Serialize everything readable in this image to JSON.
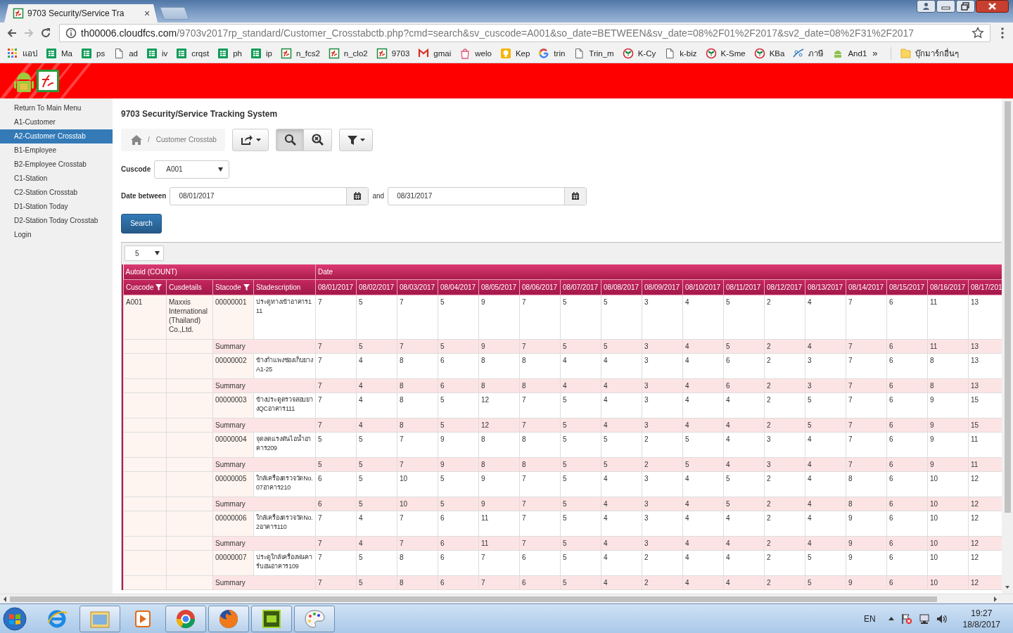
{
  "browser": {
    "tab_title": "9703 Security/Service Tra",
    "tab_close": "×",
    "url_host": "th00006.cloudfcs.com",
    "url_path": "/9703v2017rp_standard/Customer_Crosstabctb.php?cmd=search&sv_cuscode=A001&so_date=BETWEEN&sv_date=08%2F01%2F2017&sv2_date=08%2F31%2F2017",
    "bookmarks": [
      {
        "label": "แอป",
        "kind": "apps"
      },
      {
        "label": "Ma",
        "kind": "sheet"
      },
      {
        "label": "ps",
        "kind": "sheet"
      },
      {
        "label": "ad",
        "kind": "page"
      },
      {
        "label": "iv",
        "kind": "sheet"
      },
      {
        "label": "crqst",
        "kind": "sheet"
      },
      {
        "label": "ph",
        "kind": "sheet"
      },
      {
        "label": "ip",
        "kind": "sheet"
      },
      {
        "label": "n_fcs2",
        "kind": "fc"
      },
      {
        "label": "n_clo2",
        "kind": "fc"
      },
      {
        "label": "9703",
        "kind": "fc"
      },
      {
        "label": "gmai",
        "kind": "mail"
      },
      {
        "label": "welo",
        "kind": "bag"
      },
      {
        "label": "Kep",
        "kind": "bulb"
      },
      {
        "label": "trin",
        "kind": "google"
      },
      {
        "label": "Trin_m",
        "kind": "page"
      },
      {
        "label": "K-Cy",
        "kind": "bank"
      },
      {
        "label": "k-biz",
        "kind": "page"
      },
      {
        "label": "K-Sme",
        "kind": "bank"
      },
      {
        "label": "KBa",
        "kind": "bank"
      },
      {
        "label": "ภาษี",
        "kind": "swoosh"
      },
      {
        "label": "And1",
        "kind": "android"
      }
    ],
    "more_bookmarks": "»",
    "other_bookmarks": "บุ๊กมาร์กอื่นๆ"
  },
  "sidebar": {
    "items": [
      {
        "label": "Return To Main Menu",
        "selected": false
      },
      {
        "label": "A1-Customer",
        "selected": false
      },
      {
        "label": "A2-Customer Crosstab",
        "selected": true
      },
      {
        "label": "B1-Employee",
        "selected": false
      },
      {
        "label": "B2-Employee Crosstab",
        "selected": false
      },
      {
        "label": "C1-Station",
        "selected": false
      },
      {
        "label": "C2-Station Crosstab",
        "selected": false
      },
      {
        "label": "D1-Station Today",
        "selected": false
      },
      {
        "label": "D2-Station Today Crosstab",
        "selected": false
      },
      {
        "label": "Login",
        "selected": false
      }
    ]
  },
  "page": {
    "title": "9703 Security/Service Tracking System",
    "breadcrumb_separator": "/",
    "breadcrumb": "Customer Crosstab",
    "toolbar": [
      {
        "kind": "export",
        "pressed": false
      },
      {
        "kind": "search",
        "pressed": true
      },
      {
        "kind": "reset",
        "pressed": false
      },
      {
        "kind": "filter",
        "pressed": false
      }
    ],
    "cuscode_label": "Cuscode",
    "cuscode_value": "A001",
    "date_label": "Date between",
    "date_from": "08/01/2017",
    "and_label": "and",
    "date_to": "08/31/2017",
    "search_button": "Search"
  },
  "table": {
    "page_size": "5",
    "group_headers": [
      "Autoid (COUNT)",
      "Date"
    ],
    "columns": [
      {
        "label": "Cuscode",
        "filtered": true
      },
      {
        "label": "Cusdetails",
        "filtered": false
      },
      {
        "label": "Stacode",
        "filtered": true
      },
      {
        "label": "Stadescription",
        "filtered": false
      }
    ],
    "date_columns": [
      "08/01/2017",
      "08/02/2017",
      "08/03/2017",
      "08/04/2017",
      "08/05/2017",
      "08/06/2017",
      "08/07/2017",
      "08/08/2017",
      "08/09/2017",
      "08/10/2017",
      "08/11/2017",
      "08/12/2017",
      "08/13/2017",
      "08/14/2017",
      "08/15/2017",
      "08/16/2017",
      "08/17/201"
    ],
    "rows": [
      {
        "kind": "data",
        "cuscode": "A001",
        "cusdetails": "Maxxis International (Thailand) Co.,Ltd.",
        "stacode": "00000001",
        "stadescription": "ประตูทางเข้าอาคาร111",
        "values": [
          "7",
          "5",
          "7",
          "5",
          "9",
          "7",
          "5",
          "5",
          "3",
          "4",
          "5",
          "2",
          "4",
          "7",
          "6",
          "11",
          "13"
        ]
      },
      {
        "kind": "summary",
        "label": "Summary",
        "values": [
          "7",
          "5",
          "7",
          "5",
          "9",
          "7",
          "5",
          "5",
          "3",
          "4",
          "5",
          "2",
          "4",
          "7",
          "6",
          "11",
          "13"
        ]
      },
      {
        "kind": "data",
        "stacode": "00000002",
        "stadescription": "ข้างกำแพงช่องเก็บยางA1-25",
        "values": [
          "7",
          "4",
          "8",
          "6",
          "8",
          "8",
          "4",
          "4",
          "3",
          "4",
          "6",
          "2",
          "3",
          "7",
          "6",
          "8",
          "13"
        ]
      },
      {
        "kind": "summary",
        "label": "Summary",
        "values": [
          "7",
          "4",
          "8",
          "6",
          "8",
          "8",
          "4",
          "4",
          "3",
          "4",
          "6",
          "2",
          "3",
          "7",
          "6",
          "8",
          "13"
        ]
      },
      {
        "kind": "data",
        "stacode": "00000003",
        "stadescription": "ข้างประตูตรวจสอบยางQCอาคาร111",
        "values": [
          "7",
          "4",
          "8",
          "5",
          "12",
          "7",
          "5",
          "4",
          "3",
          "4",
          "4",
          "2",
          "5",
          "7",
          "6",
          "9",
          "15"
        ]
      },
      {
        "kind": "summary",
        "label": "Summary",
        "values": [
          "7",
          "4",
          "8",
          "5",
          "12",
          "7",
          "5",
          "4",
          "3",
          "4",
          "4",
          "2",
          "5",
          "7",
          "6",
          "9",
          "15"
        ]
      },
      {
        "kind": "data",
        "stacode": "00000004",
        "stadescription": "จุดลดแรงดันไอน้ำอาคาร209",
        "values": [
          "5",
          "5",
          "7",
          "9",
          "8",
          "8",
          "5",
          "5",
          "2",
          "5",
          "4",
          "3",
          "4",
          "7",
          "6",
          "9",
          "11"
        ]
      },
      {
        "kind": "summary",
        "label": "Summary",
        "values": [
          "5",
          "5",
          "7",
          "9",
          "8",
          "8",
          "5",
          "5",
          "2",
          "5",
          "4",
          "3",
          "4",
          "7",
          "6",
          "9",
          "11"
        ]
      },
      {
        "kind": "data",
        "stacode": "00000005",
        "stadescription": "ใกล้เครื่องตรวจวัดNo.07อาคาร210",
        "values": [
          "6",
          "5",
          "10",
          "5",
          "9",
          "7",
          "5",
          "4",
          "3",
          "4",
          "5",
          "2",
          "4",
          "8",
          "6",
          "10",
          "12"
        ]
      },
      {
        "kind": "summary",
        "label": "Summary",
        "values": [
          "6",
          "5",
          "10",
          "5",
          "9",
          "7",
          "5",
          "4",
          "3",
          "4",
          "5",
          "2",
          "4",
          "8",
          "6",
          "10",
          "12"
        ]
      },
      {
        "kind": "data",
        "stacode": "00000006",
        "stadescription": "ใกล้เครื่องตรวจวัดNo.2อาคาร110",
        "values": [
          "7",
          "4",
          "7",
          "6",
          "11",
          "7",
          "5",
          "4",
          "3",
          "4",
          "4",
          "2",
          "4",
          "9",
          "6",
          "10",
          "12"
        ]
      },
      {
        "kind": "summary",
        "label": "Summary",
        "values": [
          "7",
          "4",
          "7",
          "6",
          "11",
          "7",
          "5",
          "4",
          "3",
          "4",
          "4",
          "2",
          "4",
          "9",
          "6",
          "10",
          "12"
        ]
      },
      {
        "kind": "data",
        "stacode": "00000007",
        "stadescription": "ประตูใกล้เครื่องพ่นคาร์บอนอาคาร109",
        "values": [
          "7",
          "5",
          "8",
          "6",
          "7",
          "6",
          "5",
          "4",
          "2",
          "4",
          "4",
          "2",
          "5",
          "9",
          "6",
          "10",
          "12"
        ]
      },
      {
        "kind": "summary",
        "label": "Summary",
        "values": [
          "7",
          "5",
          "8",
          "6",
          "7",
          "6",
          "5",
          "4",
          "2",
          "4",
          "4",
          "2",
          "5",
          "9",
          "6",
          "10",
          "12"
        ]
      }
    ]
  },
  "taskbar": {
    "language": "EN",
    "time": "19:27",
    "date": "18/8/2017"
  }
}
